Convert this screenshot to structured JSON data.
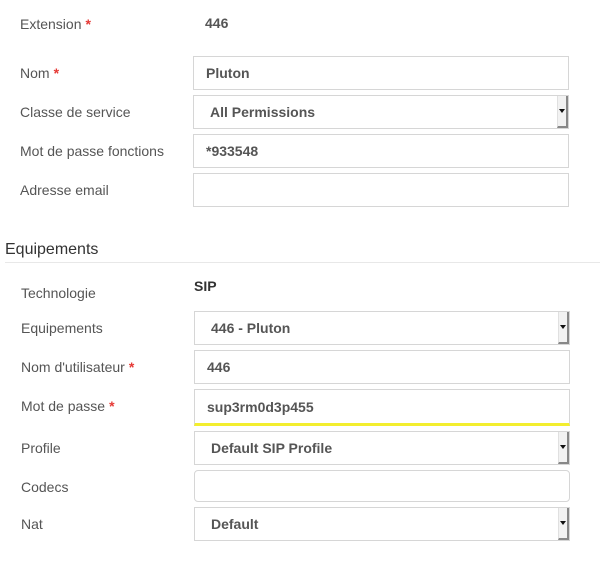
{
  "user": {
    "extension": {
      "label": "Extension",
      "required": true,
      "value": "446"
    },
    "nom": {
      "label": "Nom",
      "required": true,
      "value": "Pluton"
    },
    "classe_service": {
      "label": "Classe de service",
      "value": "All Permissions"
    },
    "mot_de_passe_fonctions": {
      "label": "Mot de passe fonctions",
      "value": "*933548"
    },
    "adresse_email": {
      "label": "Adresse email",
      "value": ""
    }
  },
  "equipements": {
    "title": "Equipements",
    "technologie": {
      "label": "Technologie",
      "value": "SIP"
    },
    "equipements": {
      "label": "Equipements",
      "value": "446 - Pluton"
    },
    "nom_utilisateur": {
      "label": "Nom d'utilisateur",
      "required": true,
      "value": "446"
    },
    "mot_de_passe": {
      "label": "Mot de passe",
      "required": true,
      "value": "sup3rm0d3p455"
    },
    "profile": {
      "label": "Profile",
      "value": "Default SIP Profile"
    },
    "codecs": {
      "label": "Codecs",
      "value": ""
    },
    "nat": {
      "label": "Nat",
      "value": "Default"
    }
  },
  "required_marker": "*",
  "colors": {
    "required": "#e53935",
    "highlight": "#f3ee2f"
  }
}
